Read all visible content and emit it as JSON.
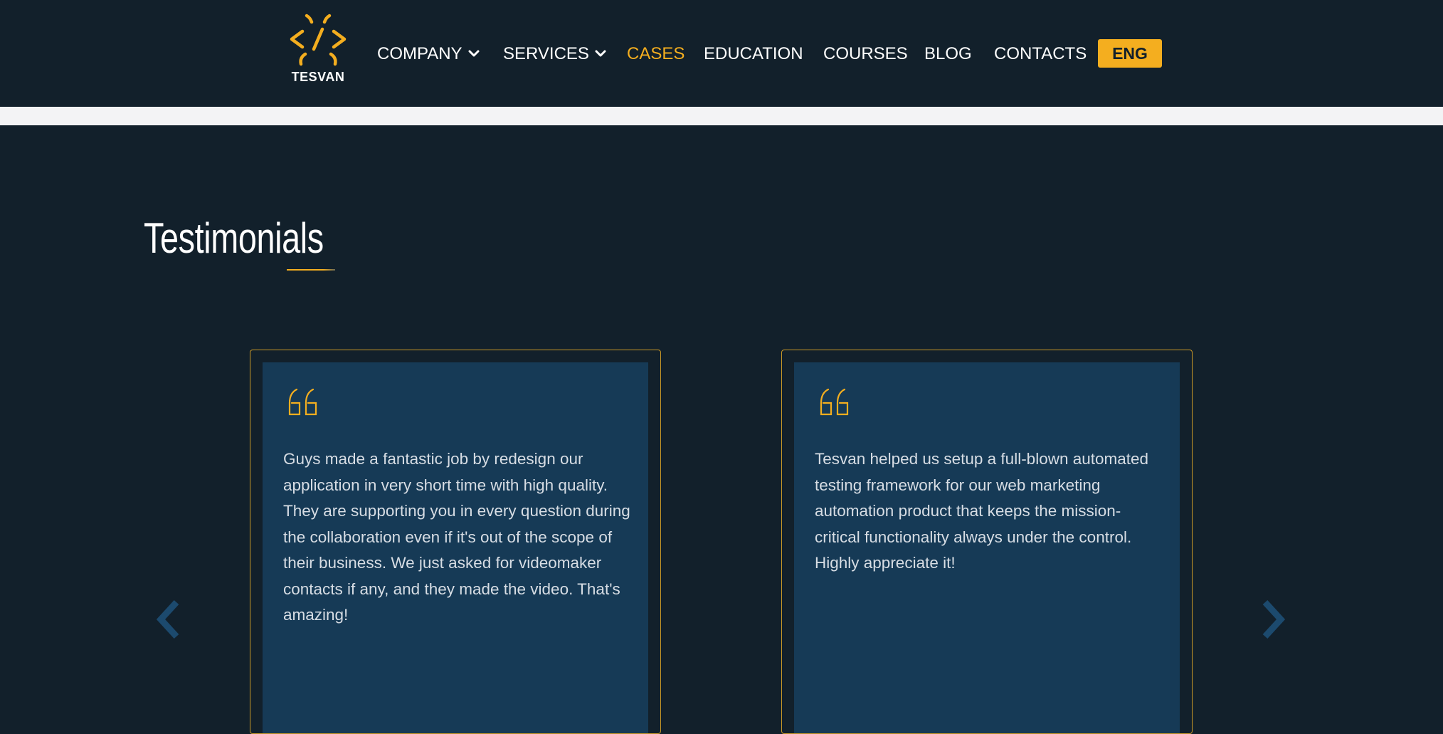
{
  "header": {
    "logo_text": "TESVAN",
    "nav": [
      {
        "label": "COMPANY",
        "has_dropdown": true,
        "active": false
      },
      {
        "label": "SERVICES",
        "has_dropdown": true,
        "active": false
      },
      {
        "label": "CASES",
        "has_dropdown": false,
        "active": true
      },
      {
        "label": "EDUCATION",
        "has_dropdown": false,
        "active": false
      },
      {
        "label": "COURSES",
        "has_dropdown": false,
        "active": false
      },
      {
        "label": "BLOG",
        "has_dropdown": false,
        "active": false
      },
      {
        "label": "CONTACTS",
        "has_dropdown": false,
        "active": false
      }
    ],
    "language": "ENG"
  },
  "testimonials": {
    "title": "Testimonials",
    "cards": [
      {
        "text": "Guys made a fantastic job by redesign our application in very short time with high quality. They are supporting you in every question during the collaboration even if it's out of the scope of their business. We just asked for videomaker contacts if any, and they made the video. That's amazing!"
      },
      {
        "text": "Tesvan helped us setup a full-blown automated testing framework for our web marketing automation product that keeps the mission-critical functionality always under the control. Highly appreciate it!"
      }
    ]
  },
  "colors": {
    "background": "#12202b",
    "accent": "#f4ae1f",
    "card": "#163a56",
    "arrow": "#1c4a6e"
  },
  "icons": {
    "logo": "code-brackets-logo-icon",
    "quote": "quote-icon",
    "prev": "chevron-left-icon",
    "next": "chevron-right-icon",
    "dropdown": "chevron-down-icon"
  }
}
